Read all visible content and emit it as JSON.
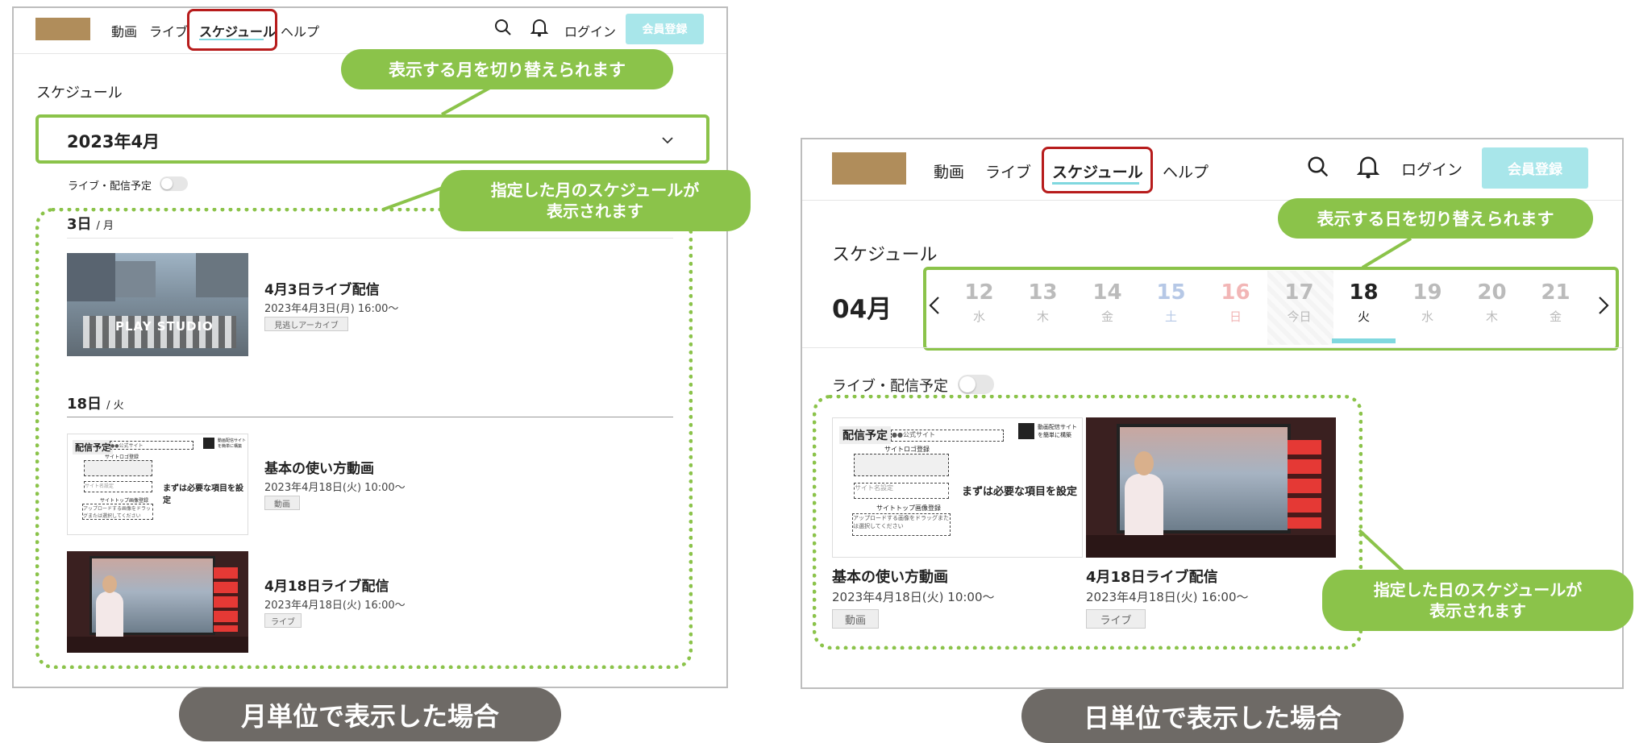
{
  "left": {
    "nav": {
      "videos": "動画",
      "live": "ライブ",
      "schedule": "スケジュール",
      "help": "ヘルプ",
      "login": "ログイン",
      "register": "会員登録"
    },
    "page_title": "スケジュール",
    "month_select": "2023年4月",
    "toggle_label": "ライブ・配信予定",
    "day1": {
      "day": "3日",
      "weekday": "/ 月"
    },
    "day2": {
      "day": "18日",
      "weekday": "/ 火"
    },
    "items": [
      {
        "title": "4月3日ライブ配信",
        "datetime": "2023年4月3日(月) 16:00〜",
        "tag": "見逃しアーカイブ",
        "thumb_text": "PLAY STUDIO"
      },
      {
        "title": "基本の使い方動画",
        "datetime": "2023年4月18日(火) 10:00〜",
        "tag": "動画"
      },
      {
        "title": "4月18日ライブ配信",
        "datetime": "2023年4月18日(火) 16:00〜",
        "tag": "ライブ"
      }
    ],
    "callout_month": "表示する月を切り替えられます",
    "callout_schedule_1": "指定した月のスケジュールが",
    "callout_schedule_2": "表示されます",
    "caption": "月単位で表示した場合"
  },
  "right": {
    "nav": {
      "videos": "動画",
      "live": "ライブ",
      "schedule": "スケジュール",
      "help": "ヘルプ",
      "login": "ログイン",
      "register": "会員登録"
    },
    "page_title": "スケジュール",
    "month": "04月",
    "dates": [
      {
        "num": "12",
        "wd": "水"
      },
      {
        "num": "13",
        "wd": "木"
      },
      {
        "num": "14",
        "wd": "金"
      },
      {
        "num": "15",
        "wd": "土"
      },
      {
        "num": "16",
        "wd": "日"
      },
      {
        "num": "17",
        "wd": "今日"
      },
      {
        "num": "18",
        "wd": "火"
      },
      {
        "num": "19",
        "wd": "水"
      },
      {
        "num": "20",
        "wd": "木"
      },
      {
        "num": "21",
        "wd": "金"
      }
    ],
    "toggle_label": "ライブ・配信予定",
    "items": [
      {
        "title": "基本の使い方動画",
        "datetime": "2023年4月18日(火) 10:00〜",
        "tag": "動画"
      },
      {
        "title": "4月18日ライブ配信",
        "datetime": "2023年4月18日(火) 16:00〜",
        "tag": "ライブ"
      }
    ],
    "callout_day": "表示する日を切り替えられます",
    "callout_schedule_1": "指定した日のスケジュールが",
    "callout_schedule_2": "表示されます",
    "caption": "日単位で表示した場合"
  },
  "wire": {
    "badge": "配信予定",
    "site": "●●公式サイト",
    "logo_reg": "サイトロゴ登録",
    "name_reg": "サイト名設定",
    "top_reg": "サイトトップ画像登録",
    "upload": "アップロードする画像をドラッグまたは選択してください",
    "heading": "まずは必要な項目を設定",
    "corner": "動画配信サイトを簡単に構築"
  },
  "colors": {
    "accent": "#8bc34a",
    "highlight": "#b71c1c",
    "register": "#a8e6ea",
    "selected_underline": "#80d8df"
  }
}
